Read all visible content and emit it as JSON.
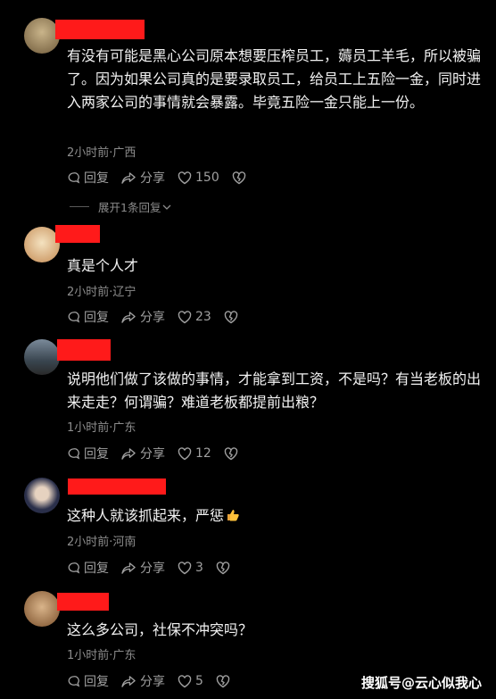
{
  "comments": [
    {
      "text": "有没有可能是黑心公司原本想要压榨员工，薅员工羊毛，所以被骗了。因为如果公司真的是要录取员工，给员工上五险一金，同时进入两家公司的事情就会暴露。毕竟五险一金只能上一份。",
      "meta": "2小时前·广西",
      "reply": "回复",
      "share": "分享",
      "likes": "150",
      "expand": "展开1条回复"
    },
    {
      "text": "真是个人才",
      "meta": "2小时前·辽宁",
      "reply": "回复",
      "share": "分享",
      "likes": "23"
    },
    {
      "text": "说明他们做了该做的事情，才能拿到工资，不是吗？有当老板的出来走走？何谓骗？难道老板都提前出粮？",
      "meta": "1小时前·广东",
      "reply": "回复",
      "share": "分享",
      "likes": "12"
    },
    {
      "text": "这种人就该抓起来，严惩",
      "meta": "2小时前·河南",
      "reply": "回复",
      "share": "分享",
      "likes": "3"
    },
    {
      "text": "这么多公司，社保不冲突吗？",
      "meta": "1小时前·广东",
      "reply": "回复",
      "share": "分享",
      "likes": "5"
    }
  ],
  "watermark": "搜狐号@云心似我心",
  "colors": {
    "redaction": "#ff1a1a",
    "background": "#000000",
    "meta": "#8c8c8c"
  },
  "icons": [
    "comment-icon",
    "share-icon",
    "heart-icon",
    "broken-heart-icon",
    "thumbs-up-emoji"
  ]
}
